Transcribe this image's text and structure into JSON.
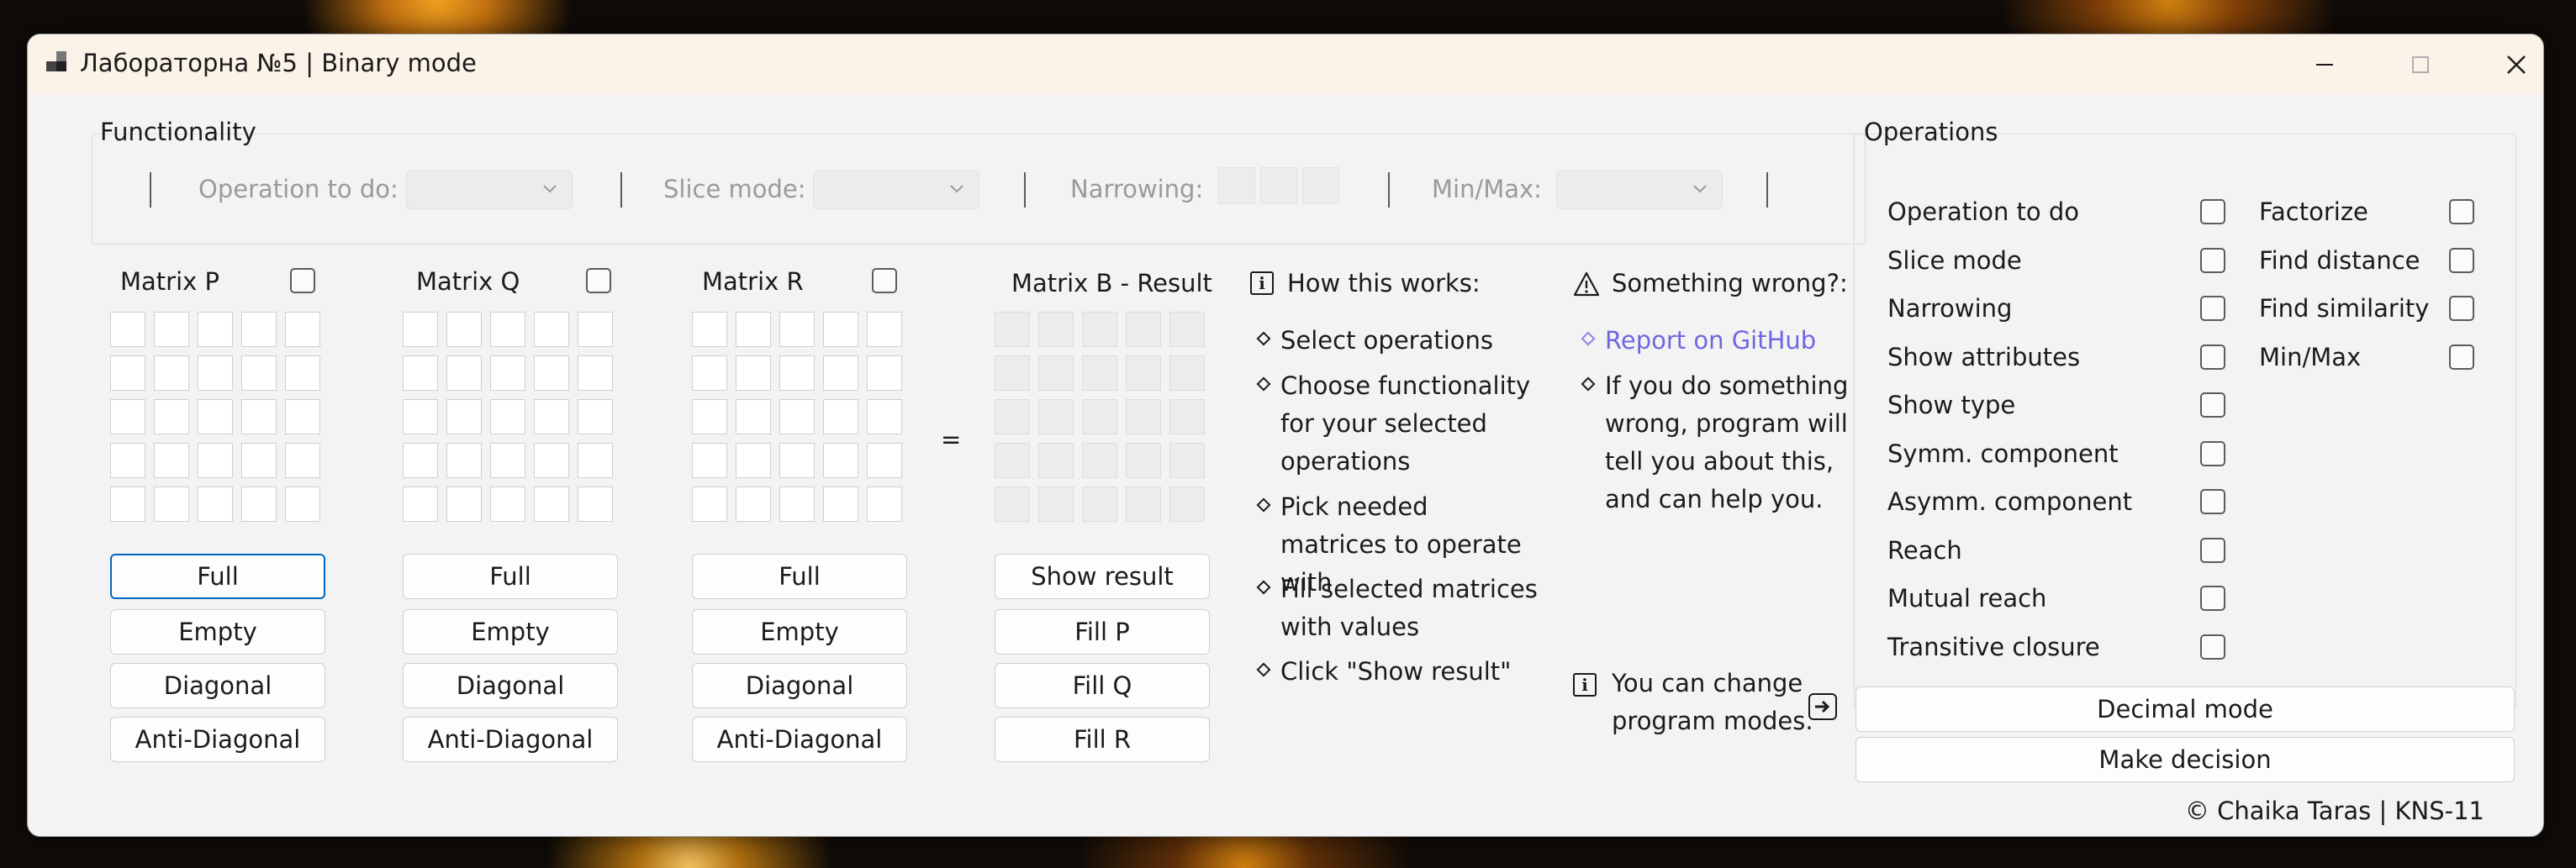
{
  "window": {
    "title": "Лабораторна №5 | Binary mode",
    "minimize_icon": "minimize-icon",
    "maximize_icon": "maximize-icon",
    "close_icon": "close-icon"
  },
  "functionality": {
    "title": "Functionality",
    "operation_label": "Operation to do:",
    "slice_label": "Slice mode:",
    "narrowing_label": "Narrowing:",
    "minmax_label": "Min/Max:"
  },
  "matrices": [
    {
      "title": "Matrix P",
      "buttons": [
        "Full",
        "Empty",
        "Diagonal",
        "Anti-Diagonal"
      ]
    },
    {
      "title": "Matrix Q",
      "buttons": [
        "Full",
        "Empty",
        "Diagonal",
        "Anti-Diagonal"
      ]
    },
    {
      "title": "Matrix R",
      "buttons": [
        "Full",
        "Empty",
        "Diagonal",
        "Anti-Diagonal"
      ]
    }
  ],
  "equals_sign": "=",
  "result": {
    "title": "Matrix B - Result",
    "buttons": [
      "Show result",
      "Fill P",
      "Fill Q",
      "Fill R"
    ]
  },
  "how_it_works": {
    "title": "How this works:",
    "steps": [
      "Select operations",
      "Choose functionality for your selected operations",
      "Pick needed matrices to operate with",
      "Fill selected matrices with values",
      "Click \"Show result\""
    ]
  },
  "something_wrong": {
    "title": "Something wrong?:",
    "link": "Report on GitHub",
    "text": "If you do something wrong, program will tell you about this, and can help you."
  },
  "modes_hint": "You can change program modes.",
  "operations": {
    "title": "Operations",
    "left": [
      "Operation to do",
      "Slice mode",
      "Narrowing",
      "Show attributes",
      "Show type",
      "Symm. component",
      "Asymm. component",
      "Reach",
      "Mutual reach",
      "Transitive closure"
    ],
    "right": [
      "Factorize",
      "Find distance",
      "Find similarity",
      "Min/Max"
    ]
  },
  "actions": {
    "decimal_mode": "Decimal mode",
    "make_decision": "Make decision"
  },
  "footer": "© Chaika Taras | KNS-11"
}
